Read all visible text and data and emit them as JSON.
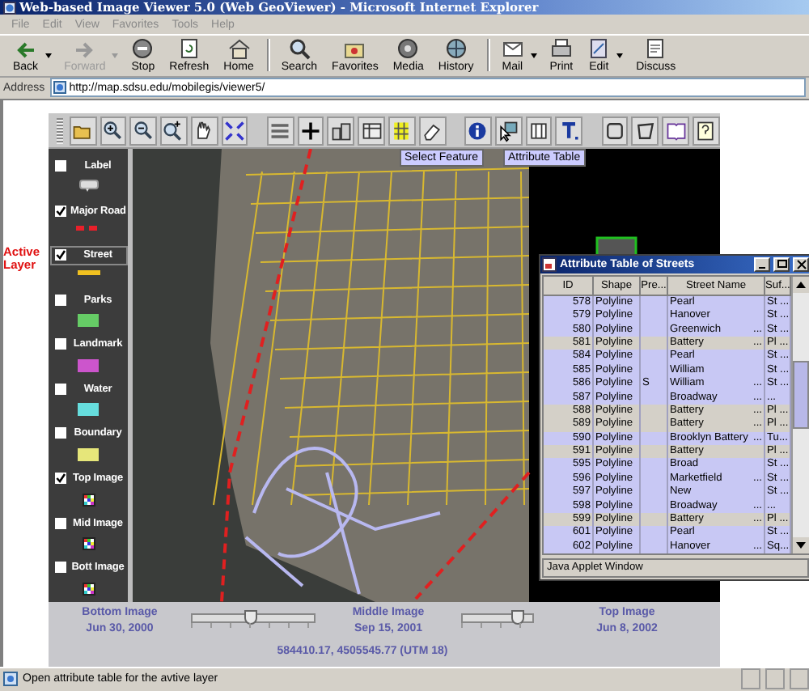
{
  "window": {
    "title": "Web-based Image Viewer 5.0 (Web GeoViewer) - Microsoft Internet Explorer"
  },
  "menu": [
    "File",
    "Edit",
    "View",
    "Favorites",
    "Tools",
    "Help"
  ],
  "toolbar": [
    {
      "label": "Back",
      "kind": "back",
      "disabled": false,
      "dropdown": true,
      "separator_before": false
    },
    {
      "label": "Forward",
      "kind": "forward",
      "disabled": true,
      "dropdown": true,
      "separator_before": false
    },
    {
      "label": "Stop",
      "kind": "stop",
      "disabled": false,
      "dropdown": false,
      "separator_before": false
    },
    {
      "label": "Refresh",
      "kind": "refresh",
      "disabled": false,
      "dropdown": false,
      "separator_before": false
    },
    {
      "label": "Home",
      "kind": "home",
      "disabled": false,
      "dropdown": false,
      "separator_before": false
    },
    {
      "label": "Search",
      "kind": "search",
      "disabled": false,
      "dropdown": false,
      "separator_before": true
    },
    {
      "label": "Favorites",
      "kind": "favorites",
      "disabled": false,
      "dropdown": false,
      "separator_before": false
    },
    {
      "label": "Media",
      "kind": "media",
      "disabled": false,
      "dropdown": false,
      "separator_before": false
    },
    {
      "label": "History",
      "kind": "history",
      "disabled": false,
      "dropdown": false,
      "separator_before": false
    },
    {
      "label": "Mail",
      "kind": "mail",
      "disabled": false,
      "dropdown": true,
      "separator_before": true
    },
    {
      "label": "Print",
      "kind": "print",
      "disabled": false,
      "dropdown": false,
      "separator_before": false
    },
    {
      "label": "Edit",
      "kind": "edit",
      "disabled": false,
      "dropdown": true,
      "separator_before": false
    },
    {
      "label": "Discuss",
      "kind": "discuss",
      "disabled": false,
      "dropdown": false,
      "separator_before": false
    }
  ],
  "address": {
    "label": "Address",
    "url": "http://map.sdsu.edu/mobilegis/viewer5/"
  },
  "active_layer_note": "Active Layer",
  "tooltips": [
    "Select Feature",
    "Attribute Table"
  ],
  "layers": [
    {
      "label": "Label",
      "checked": false,
      "active": false,
      "kind": "label"
    },
    {
      "label": "Major Road",
      "checked": true,
      "active": false,
      "kind": "dashed",
      "color": "#e8202a"
    },
    {
      "label": "Street",
      "checked": true,
      "active": true,
      "kind": "line",
      "color": "#f0c020"
    },
    {
      "label": "Parks",
      "checked": false,
      "active": false,
      "kind": "fill",
      "color": "#66cc66"
    },
    {
      "label": "Landmark",
      "checked": false,
      "active": false,
      "kind": "fill",
      "color": "#cc55cc"
    },
    {
      "label": "Water",
      "checked": false,
      "active": false,
      "kind": "fill",
      "color": "#66dddd"
    },
    {
      "label": "Boundary",
      "checked": false,
      "active": false,
      "kind": "fill",
      "color": "#e6e67a"
    },
    {
      "label": "Top Image",
      "checked": true,
      "active": false,
      "kind": "image"
    },
    {
      "label": "Mid Image",
      "checked": false,
      "active": false,
      "kind": "image"
    },
    {
      "label": "Bott Image",
      "checked": false,
      "active": false,
      "kind": "image"
    }
  ],
  "image_slider": {
    "stops": [
      {
        "label": "Bottom Image",
        "date": "Jun 30, 2000"
      },
      {
        "label": "Middle Image",
        "date": "Sep 15, 2001"
      },
      {
        "label": "Top Image",
        "date": "Jun 8, 2002"
      }
    ],
    "handles": [
      {
        "level": 0.48
      },
      {
        "level": 0.8
      }
    ],
    "coordinates": "584410.17, 4505545.77 (UTM 18)"
  },
  "attribute_table": {
    "title": "Attribute Table of Streets",
    "columns": [
      "ID",
      "Shape",
      "Pre...",
      "Street Name",
      "Suf..."
    ],
    "rows": [
      {
        "id": "578",
        "shape": "Polyline",
        "name": "Pearl",
        "suffix": "St ...",
        "selected": true
      },
      {
        "id": "579",
        "shape": "Polyline",
        "name": "Hanover",
        "suffix": "St ...",
        "selected": true
      },
      {
        "id": "580",
        "shape": "Polyline",
        "name": "Greenwich",
        "name_more": "...",
        "suffix": "St ...",
        "selected": true
      },
      {
        "id": "581",
        "shape": "Polyline",
        "name": "Battery",
        "name_more": "...",
        "suffix": "Pl ...",
        "selected": false
      },
      {
        "id": "584",
        "shape": "Polyline",
        "name": "Pearl",
        "suffix": "St ...",
        "selected": true
      },
      {
        "id": "585",
        "shape": "Polyline",
        "name": "William",
        "suffix": "St ...",
        "selected": true
      },
      {
        "id": "586",
        "shape": "Polyline",
        "prefix": "S",
        "name": "William",
        "name_more": "...",
        "suffix": "St ...",
        "selected": true
      },
      {
        "id": "587",
        "shape": "Polyline",
        "name": "Broadway",
        "name_more": "...",
        "suffix": "...",
        "selected": true
      },
      {
        "id": "588",
        "shape": "Polyline",
        "name": "Battery",
        "name_more": "...",
        "suffix": "Pl ...",
        "selected": false
      },
      {
        "id": "589",
        "shape": "Polyline",
        "name": "Battery",
        "name_more": "...",
        "suffix": "Pl ...",
        "selected": false
      },
      {
        "id": "590",
        "shape": "Polyline",
        "name": "Brooklyn Battery",
        "name_more": "...",
        "suffix": "Tu...",
        "selected": true
      },
      {
        "id": "591",
        "shape": "Polyline",
        "name": "Battery",
        "suffix": "Pl ...",
        "selected": false
      },
      {
        "id": "595",
        "shape": "Polyline",
        "name": "Broad",
        "suffix": "St ...",
        "selected": true
      },
      {
        "id": "596",
        "shape": "Polyline",
        "name": "Marketfield",
        "name_more": "...",
        "suffix": "St ...",
        "selected": true
      },
      {
        "id": "597",
        "shape": "Polyline",
        "name": "New",
        "suffix": "St ...",
        "selected": true
      },
      {
        "id": "598",
        "shape": "Polyline",
        "name": "Broadway",
        "name_more": "...",
        "suffix": "...",
        "selected": true
      },
      {
        "id": "599",
        "shape": "Polyline",
        "name": "Battery",
        "name_more": "...",
        "suffix": "Pl ...",
        "selected": false
      },
      {
        "id": "601",
        "shape": "Polyline",
        "name": "Pearl",
        "suffix": "St ...",
        "selected": true
      },
      {
        "id": "602",
        "shape": "Polyline",
        "name": "Hanover",
        "name_more": "...",
        "suffix": "Sq...",
        "selected": true
      }
    ],
    "footer": "Java Applet Window"
  },
  "status_bar": {
    "text": "Open attribute table for the avtive layer"
  }
}
